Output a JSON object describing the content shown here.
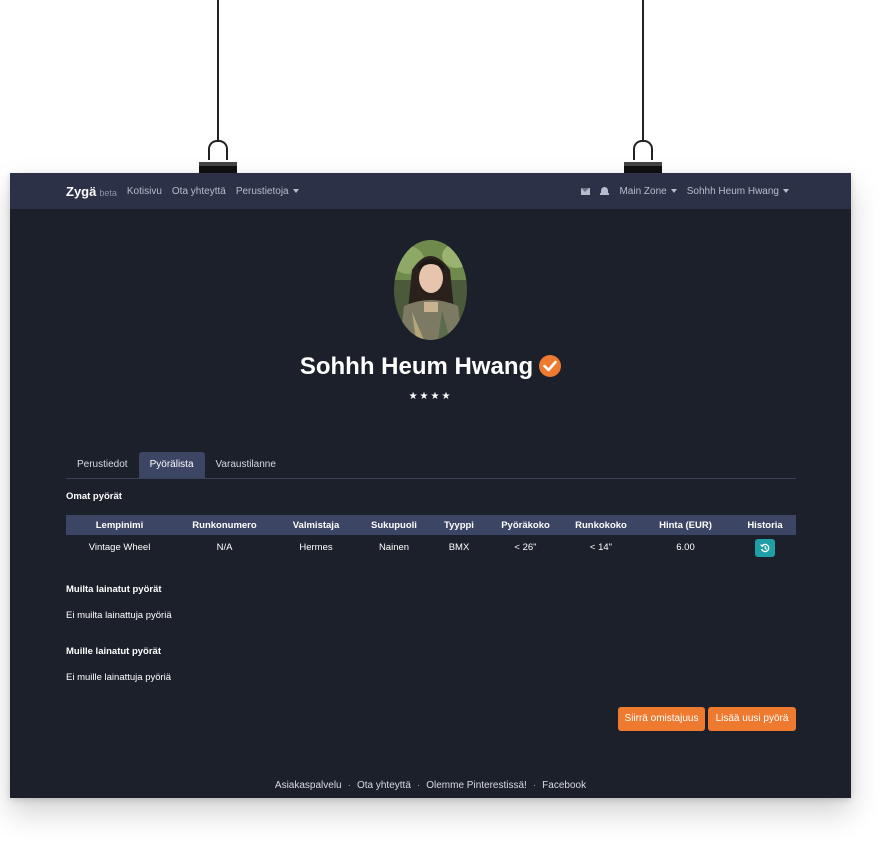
{
  "navbar": {
    "brand": "Zygä",
    "brand_tag": "beta",
    "links": [
      "Kotisivu",
      "Ota yhteyttä",
      "Perustietoja"
    ],
    "zone": "Main Zone",
    "user": "Sohhh Heum Hwang",
    "icons": [
      "mail-icon",
      "bell-icon"
    ]
  },
  "profile": {
    "name": "Sohhh Heum Hwang",
    "verified": true,
    "rating": "★★★★"
  },
  "tabs": [
    {
      "label": "Perustiedot",
      "active": false
    },
    {
      "label": "Pyörälista",
      "active": true
    },
    {
      "label": "Varaustilanne",
      "active": false
    }
  ],
  "own_bikes": {
    "title": "Omat pyörät",
    "columns": [
      "Lempinimi",
      "Runkonumero",
      "Valmistaja",
      "Sukupuoli",
      "Tyyppi",
      "Pyöräkoko",
      "Runkokoko",
      "Hinta (EUR)",
      "Historia"
    ],
    "rows": [
      [
        "Vintage Wheel",
        "N/A",
        "Hermes",
        "Nainen",
        "BMX",
        "< 26\"",
        "< 14\"",
        "6.00"
      ]
    ]
  },
  "borrowed_from_others": {
    "title": "Muilta lainatut pyörät",
    "empty_text": "Ei muilta lainattuja pyöriä"
  },
  "lent_to_others": {
    "title": "Muille lainatut pyörät",
    "empty_text": "Ei muille lainattuja pyöriä"
  },
  "actions": {
    "transfer_label": "Siirrä omistajuus",
    "add_label": "Lisää uusi pyörä"
  },
  "footer": {
    "links": [
      "Asiakaspalvelu",
      "Ota yhteyttä",
      "Olemme Pinterestissä!",
      "Facebook"
    ]
  },
  "colors": {
    "navbar_bg": "#2c3148",
    "page_bg": "#1c202b",
    "accent": "#ee7a2f",
    "table_header_bg": "#3c4563",
    "history_button": "#1f9fa6"
  }
}
